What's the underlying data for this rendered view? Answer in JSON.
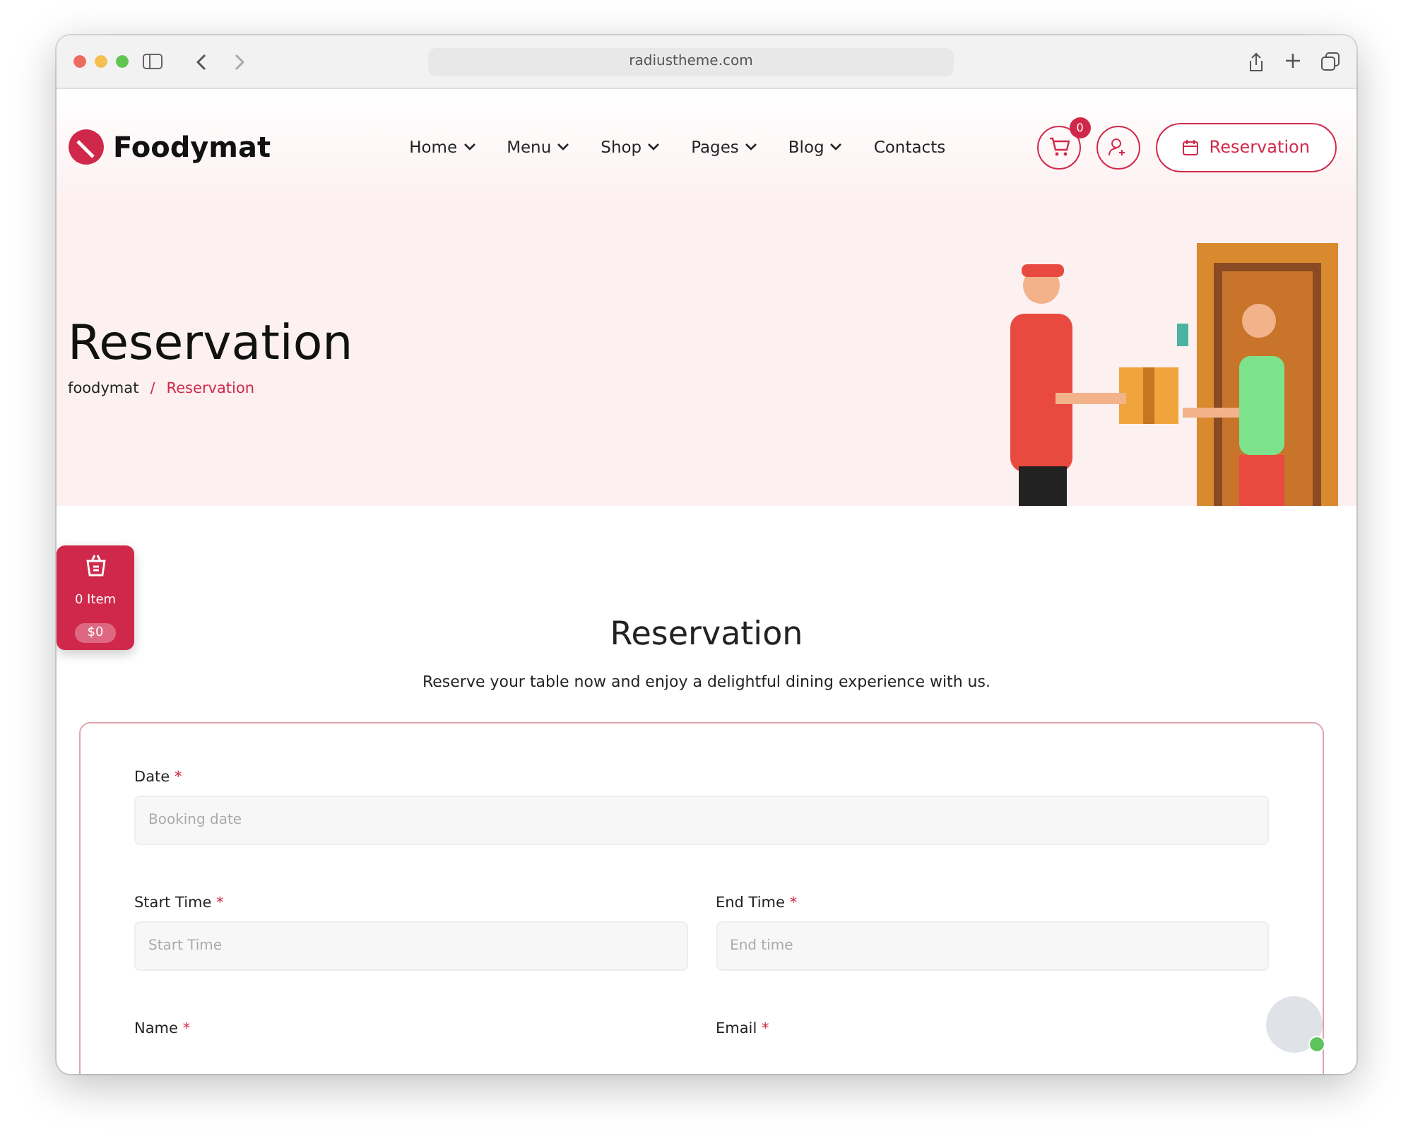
{
  "browser": {
    "url": "radiustheme.com"
  },
  "header": {
    "logo": "Foodymat",
    "nav": [
      {
        "label": "Home",
        "has_menu": true
      },
      {
        "label": "Menu",
        "has_menu": true
      },
      {
        "label": "Shop",
        "has_menu": true
      },
      {
        "label": "Pages",
        "has_menu": true
      },
      {
        "label": "Blog",
        "has_menu": true
      },
      {
        "label": "Contacts",
        "has_menu": false
      }
    ],
    "cart_count": "0",
    "button": "Reservation"
  },
  "hero": {
    "title": "Reservation",
    "breadcrumb": [
      {
        "label": "foodymat",
        "current": false
      },
      {
        "label": "Reservation",
        "current": true
      }
    ],
    "separator": "/"
  },
  "mini_cart": {
    "items": "0 Item",
    "total": "$0"
  },
  "section": {
    "title": "Reservation",
    "subtitle": "Reserve your table now and enjoy a delightful dining experience with us."
  },
  "form": {
    "rows": [
      [
        {
          "label": "Date",
          "mark": "*",
          "placeholder": "Booking date"
        }
      ],
      [
        {
          "label": "Start Time",
          "mark": "*",
          "placeholder": "Start Time"
        },
        {
          "label": "End Time",
          "mark": "*",
          "placeholder": "End time"
        }
      ],
      [
        {
          "label": "Name",
          "mark": "*"
        },
        {
          "label": "Email",
          "mark": "*"
        }
      ]
    ]
  },
  "chat": {
    "online": true
  }
}
